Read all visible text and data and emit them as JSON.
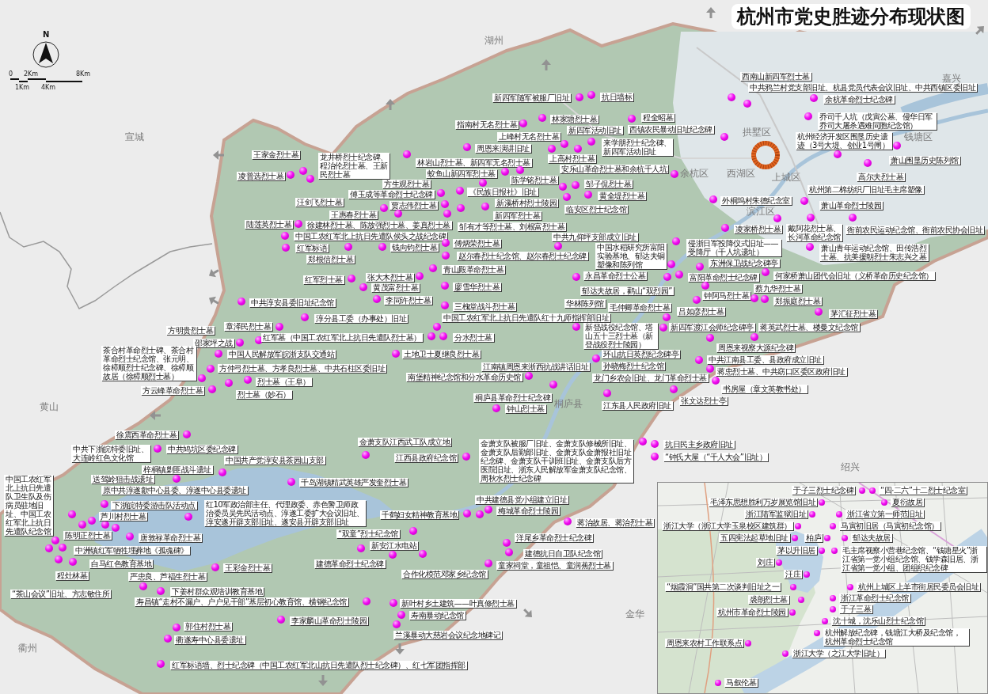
{
  "title": "杭州市党史胜迹分布现状图",
  "compass": {
    "letter": "N"
  },
  "scale_bar": {
    "upper_labels": [
      "0",
      "2Km",
      "8Km"
    ],
    "lower_labels": [
      "1Km",
      "4Km"
    ]
  },
  "place_names": [
    "湖州",
    "嘉兴",
    "宣城",
    "拱墅区",
    "钱塘区",
    "余杭区",
    "西湖区",
    "上城区",
    "滨江区",
    "黄山",
    "桐庐县",
    "绍兴",
    "金华",
    "衢州"
  ],
  "sites": [
    "西南山新四军烈士墓",
    "中共鸦兰村党支部旧址、杭县党员代表会议旧址、中共西镇区委旧址",
    "新四军随军被服厂旧址",
    "抗日墙标",
    "余杭革命烈士纪念碑",
    "指南村无名烈士墓",
    "林家塘烈士墓",
    "程全昭墓",
    "新四军活动旧址",
    "西镇农民暴动旧址纪念碑",
    "乔司千人坑（戊寅公墓、侵华日军乔司大屠杀遇难同胞纪念馆）",
    "上峰村无名烈士墓",
    "周恩来演讲旧址",
    "来学朋烈士纪念碑、新四军活动旧址",
    "杭州经济开发区围垦历史遗迹（3号大堤、创业1号闸）",
    "王家金烈士墓",
    "龙井桥烈士纪念碑、程治伦烈士墓、王新民烈士墓",
    "林岩山烈士墓、新四军无名烈士墓",
    "上高村烈士墓",
    "萧山围垦历史陈列馆",
    "凌普选烈士墓",
    "蛟鱼山新四军烈士墓",
    "安乐山革命烈士墓和余杭千人坑",
    "方生观烈士墓",
    "陈学铭烈士墓",
    "邹子侃烈士墓",
    "高尔夫烈士墓",
    "傅玉成等革命烈士纪念碑",
    "《民族日报社》旧址",
    "黄全堤烈士墓",
    "杭州第二棉纺织厂旧址毛主席塑像",
    "汪剑飞烈士墓",
    "贾志伟烈士墓",
    "新溪桥村烈士陵园",
    "外桐坞村朱德纪念室",
    "临安区烈士纪念馆",
    "萧山革命烈士陵园",
    "王惠春烈士墓",
    "新四军烈士墓",
    "陆莲英烈士墓",
    "徐建林烈士墓、陈放强烈士墓、姜真烈士墓",
    "邹有才等烈士墓、刘根富烈士墓",
    "中国工农红军北上抗日先遣队侯头之战纪念碑",
    "凌家桥烈士墓",
    "中共九仰坪支部成立旧址",
    "戴阿花烈士墓、长河革命纪念馆",
    "衙前农民运动纪念馆、衙前农民协会旧址",
    "红军标语",
    "钱向钧烈士墓",
    "傅炳荣烈士墓",
    "郑根信烈士墓",
    "赵尔春烈士纪念馆、赵尔春烈士纪念碑",
    "中国水稻研究所富阳实验基地、郁达夫铜塑像和陈列馆",
    "侵浙日军投降仪式旧址——受降厅（千人坑遗址）",
    "东洲保卫战纪念碑亭",
    "萧山青年运动纪念馆、田传浩烈士墓、抗美援朝烈士朱志兴之墓",
    "青山殿革命烈士墓",
    "红军烈士墓",
    "张大木烈士墓",
    "永昌革命烈士公墓",
    "富阳革命烈士纪念碑",
    "何家桥萧山团代会旧址（义桥革命历史纪念馆）",
    "黄茂富烈士墓",
    "廖雪华烈士墓",
    "郁达夫故居，鹳山“双烈园”",
    "钟阿马烈士墓",
    "蔡九华烈士墓",
    "中共淳安县委旧址纪念馆",
    "李同许烈士墓",
    "三槐堂战斗烈士墓",
    "华林陈列馆",
    "毛仲卿革命烈士墓",
    "郑振庭烈士墓",
    "淳分县工委（办事处）旧址",
    "中国工农红军北上抗日先遣队红十九师指挥部旧址",
    "吕如彦烈士墓",
    "茅汇征烈士墓",
    "方明贵烈士墓",
    "章泽民烈士墓",
    "新登战役纪念馆、塔山五十三烈士墓（新登战役烈士陵园）",
    "新四军渡江会师纪念碑亭",
    "蒋英武烈士墓、楼曼文纪念馆",
    "邵家坪之战",
    "红军墓（中国工农红军北上抗日先遣队烈士墓）",
    "分水烈士墓",
    "茶合村革命烈士碑、茶合村革命烈士纪念馆、张元明、徐樟顺烈士纪念碑、徐樟顺故居（徐樟顺烈士墓）",
    "中国人民解放军皖浙支队交通站",
    "土地卫士夏继良烈士墓",
    "环山抗日英烈纪念碑亭",
    "周恩来视察大源纪念碑",
    "江南镇周恩来浙西抗战讲话旧址",
    "孙晓梅烈士纪念馆",
    "中共江南县工委、县政府成立旧址",
    "方仲弓烈士墓、方孝良烈士墓、中共石柱区委旧址",
    "南堡精神纪念馆和分水革命历史馆",
    "龙门乡农会旧址、龙门革命烈士墓",
    "蒋忠烈士墓、中共窈口区委区政府旧址",
    "方云峰革命烈士墓",
    "烈士墓（王阜）",
    "烈士墓（妙石）",
    "书房屋（章文英教书处）",
    "桐庐县革命烈士纪念碑",
    "钟山烈士墓",
    "江东县人民政府旧址",
    "张文达烈士亭",
    "徐震西革命烈士墓",
    "中共下浙皖特委旧址、大连岭红色文化馆",
    "中共鸠坑区委纪念碑",
    "金萧支队江西武工队成立地",
    "金萧支队被服厂旧址、金萧支队修械所旧址、金萧支队后勤部旧址、金萧支队金萧报社旧址纪念碑、金萧支队干训班旧址、金萧支队后方医院旧址、浙东人民解放军金萧支队纪念馆、周秋水烈士纪念碑",
    "抗日民主乡政府旧址",
    "中国共产党淳安县茶园山支部",
    "江西县政府纪念馆",
    "“钟氏大屋（“千人大会”旧址）",
    "梓桐镇剿匪战斗遗址",
    "中国工农红军北上抗日先遣队卫生队及伤病员驻地旧址、中国工农红军北上抗日先遣队纪念馆",
    "送驾岭狙击战遗址",
    "原中共淳遂歙中心县委、淳遂中心县委遗址",
    "千岛湖镇精武英雄严发奎烈士墓",
    "下浙皖特委游击队活动点",
    "红10军政治部主任、代理政委、赤色警卫师政治委员吴先民活动点、淳遂工委扩大会议旧址、淳安遂开辟支部旧址、遂安县开辟支部旧址",
    "中共建德县党小组建立旧址",
    "芦川村烈士墓",
    "千鹤妇女精神教育基地",
    "梅城革命烈士陵园",
    "蒋治故居、蒋治烈士墓",
    "陈明正烈士墓",
    "唐敦禄革命烈士墓",
    "“双童”烈士纪念馆",
    "洋尾乡革命烈士纪念碑",
    "中洲镇红军牺牲埋葬地《孤魂碑》",
    "新安江水电站",
    "建德抗日自卫队纪念馆",
    "白马红色教育基地",
    "王彩金烈士墓",
    "建德革命烈士纪念碑",
    "童家祠堂，童祖恺、童润蕉烈士墓",
    "程灶林墓",
    "严忠良、芦福生烈士墓",
    "合作化模范邓家乡纪念馆",
    "“茶山会议”旧址、方志敏住所",
    "下姜村群众观培训教育基地",
    "寿昌镇“走村不漏户、户户见干部”基层初心教育馆、横钢纪念馆",
    "新叶村乡土建筑——叶真修烈士墓",
    "李家麟山革命烈士陵园",
    "寿南暴动纪念馆",
    "郭住村烈士墓",
    "衢遂寿中心县委遗址",
    "兰溪暴动大慈岩会议纪念地碑记",
    "红军标语墙、烈士纪念碑（中国工农红军北山抗日先遣队烈士纪念碑）、红七军团指挥部"
  ],
  "inset": {
    "sites": [
      "于子三烈士纪念碑",
      "“四·二六”十二烈士纪念室",
      "毛泽东思想胜利万岁展览馆旧址",
      "夏衍故居",
      "浙江陆军监狱旧址",
      "浙江省立第一师范旧址",
      "浙江大学（浙江大学玉泉校区建筑群）",
      "马寅初旧居（马寅初纪念馆）",
      "五四宪法起草地旧址",
      "柏庐",
      "郁达夫故居",
      "茅以升旧居",
      "刘庄",
      "汪庄",
      "毛主席视察小营巷纪念馆、“钱塘星火”浙江省第一党小组纪念馆、钱学森旧居、浙江省第一党小组、团组织纪念碑",
      "“烟霞洞”国共第二次谈判旧址之一",
      "杭州上城区上羊市街居民委员会旧址",
      "裘朗烈士墓",
      "浙江革命烈士纪念馆",
      "杭州市革命烈士陵园",
      "于子三墓",
      "沈十城，沈乐山烈士纪念馆",
      "周恩来农村工作联系点",
      "杭州解放纪念碑，钱塘江大桥及纪念馆，杭州革命烈士纪念馆",
      "浙江大学（之江大学旧址）",
      "马叙伦墓"
    ]
  }
}
